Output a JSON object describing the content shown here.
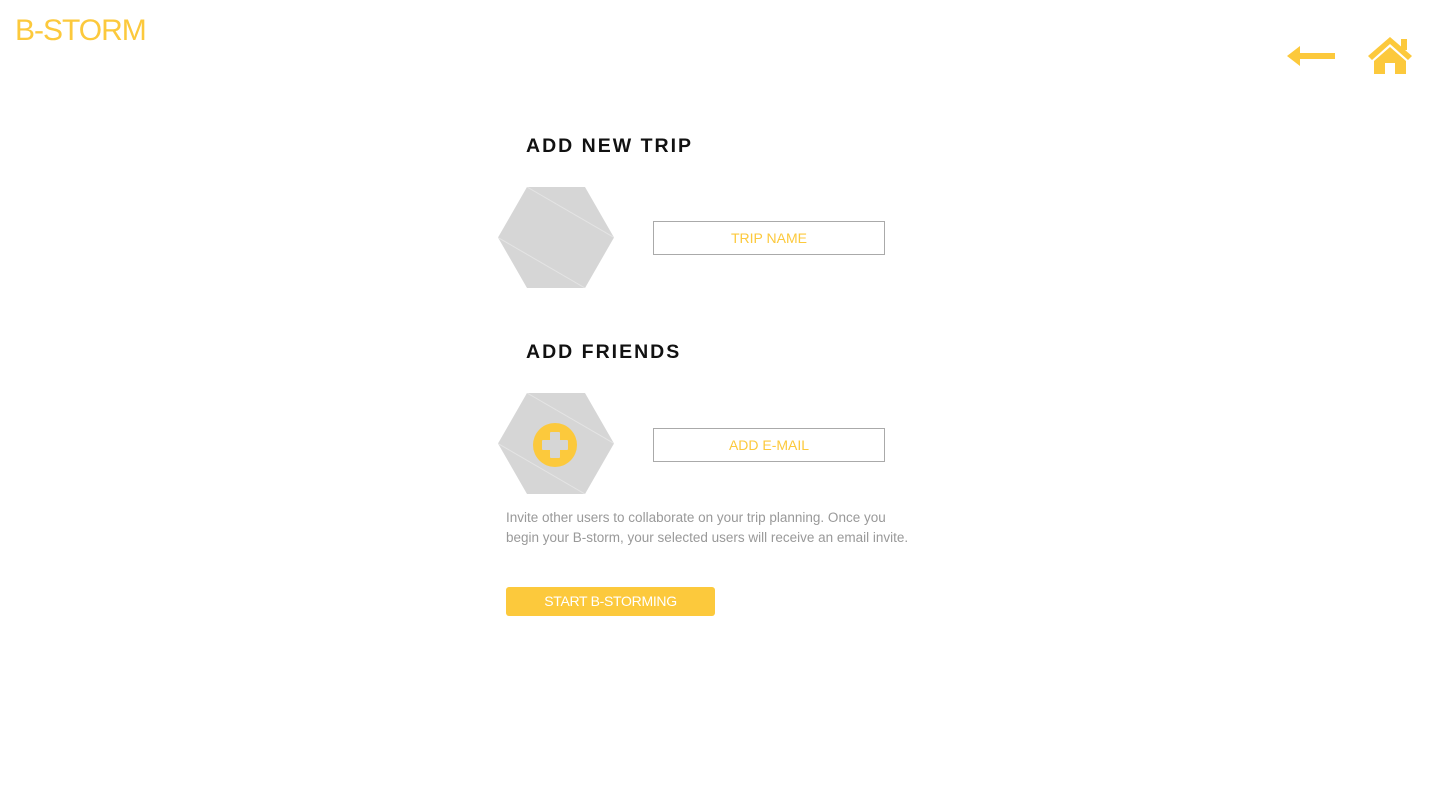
{
  "header": {
    "brand": "B-STORM",
    "back_icon": "back-arrow-icon",
    "home_icon": "home-icon"
  },
  "trip": {
    "title": "ADD NEW TRIP",
    "image_placeholder_icon": "hexagon-image-placeholder",
    "name_placeholder": "TRIP NAME"
  },
  "friends": {
    "title": "ADD FRIENDS",
    "add_icon": "plus-circle-icon",
    "email_placeholder": "ADD E-MAIL",
    "help_text": "Invite other users to collaborate on your trip planning. Once you begin your B-storm, your selected users will receive an email invite."
  },
  "actions": {
    "start_label": "START B-STORMING"
  },
  "colors": {
    "accent": "#fcc93c",
    "placeholder_gray": "#d6d6d6",
    "help_text": "#999999"
  }
}
